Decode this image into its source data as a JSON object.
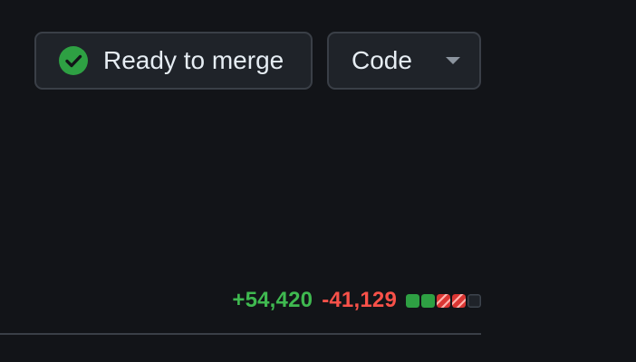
{
  "merge_status": {
    "label": "Ready to merge",
    "icon": "check-circle-icon",
    "icon_color": "#2ea043"
  },
  "code_button": {
    "label": "Code",
    "icon": "caret-down-icon"
  },
  "diffstat": {
    "additions": "+54,420",
    "deletions": "-41,129",
    "blocks": [
      "added",
      "added",
      "deleted",
      "deleted",
      "neutral"
    ],
    "colors": {
      "added": "#2ea043",
      "deleted": "#da3633",
      "neutral": "#30363d",
      "additions_text": "#3fb950",
      "deletions_text": "#f85149"
    }
  }
}
